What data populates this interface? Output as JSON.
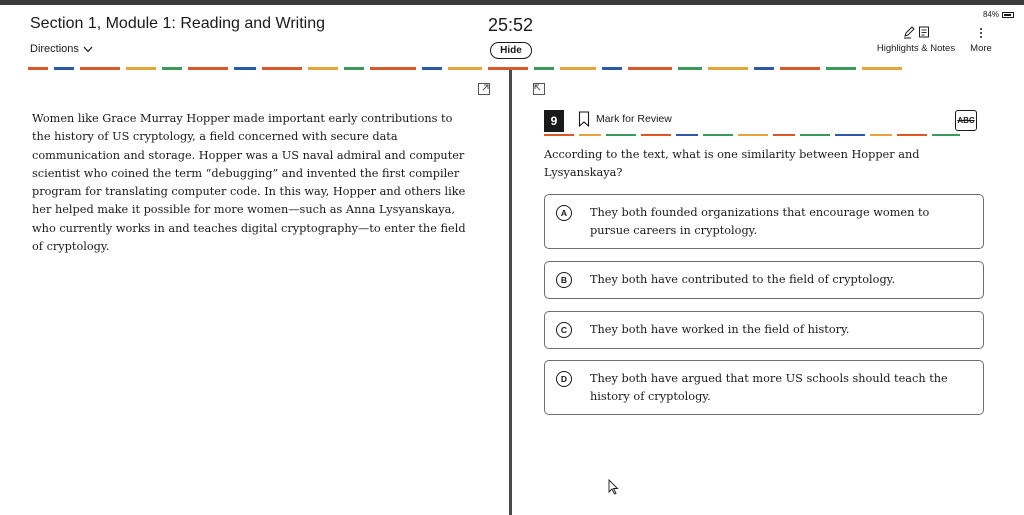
{
  "header": {
    "section_title": "Section 1, Module 1: Reading and Writing",
    "directions_label": "Directions",
    "timer": "25:52",
    "hide_label": "Hide",
    "battery": "84%",
    "highlights_label": "Highlights & Notes",
    "more_label": "More"
  },
  "passage": {
    "text": "Women like Grace Murray Hopper made important early contributions to the history of US cryptology, a field concerned with secure data communication and storage. Hopper was a US naval admiral and computer scientist who coined the term “debugging” and invented the first compiler program for translating computer code. In this way, Hopper and others like her helped make it possible for more women—such as Anna Lysyanskaya, who currently works in and teaches digital cryptography—to enter the field of cryptology."
  },
  "question": {
    "number": "9",
    "mark_for_review": "Mark for Review",
    "abc_label": "ABC",
    "prompt": "According to the text, what is one similarity between Hopper and Lysyanskaya?",
    "choices": [
      {
        "letter": "A",
        "text": "They both founded organizations that encourage women to pursue careers in cryptology."
      },
      {
        "letter": "B",
        "text": "They both have contributed to the field of cryptology."
      },
      {
        "letter": "C",
        "text": "They both have worked in the field of history."
      },
      {
        "letter": "D",
        "text": "They both have argued that more US schools should teach the history of cryptology."
      }
    ]
  },
  "colors": {
    "dash_palette": [
      "#d9572b",
      "#e8a33a",
      "#3a9a5b",
      "#2d5aa8",
      "#b0b0b0"
    ],
    "text": "#1a1a1a",
    "divider": "#4a4a4a"
  },
  "icons": {
    "directions_chevron": "chevron-down-icon",
    "highlight": "pen-icon",
    "notes": "note-icon",
    "more": "vertical-dots-icon",
    "mark": "bookmark-icon",
    "expand": "expand-icon",
    "collapse": "collapse-icon",
    "strike": "abc-strikethrough-icon",
    "pointer": "mouse-cursor-icon"
  }
}
